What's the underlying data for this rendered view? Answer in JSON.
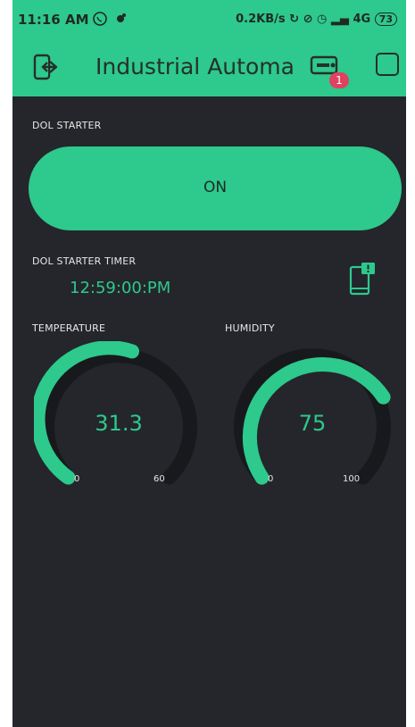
{
  "status_bar": {
    "time": "11:16 AM",
    "right_text": "0.2KB/s",
    "network": "4G",
    "battery": "73"
  },
  "app_bar": {
    "title": "Industrial Automa",
    "back_icon": "exit-icon",
    "device_icon": "device-icon",
    "notification_count": "1",
    "menu_icon": "square-icon"
  },
  "dol_starter": {
    "label": "DOL STARTER",
    "button_label": "ON"
  },
  "timer": {
    "label": "DOL STARTER TIMER",
    "value": "12:59:00:PM",
    "icon": "phone-notification-icon"
  },
  "temperature": {
    "label": "TEMPERATURE",
    "value": "31.3",
    "min": "0",
    "max": "60"
  },
  "humidity": {
    "label": "HUMIDITY",
    "value": "75",
    "min": "0",
    "max": "100"
  },
  "colors": {
    "accent": "#2ec98c",
    "background": "#24262b",
    "track": "#18191c",
    "text": "#e6e6e6"
  }
}
